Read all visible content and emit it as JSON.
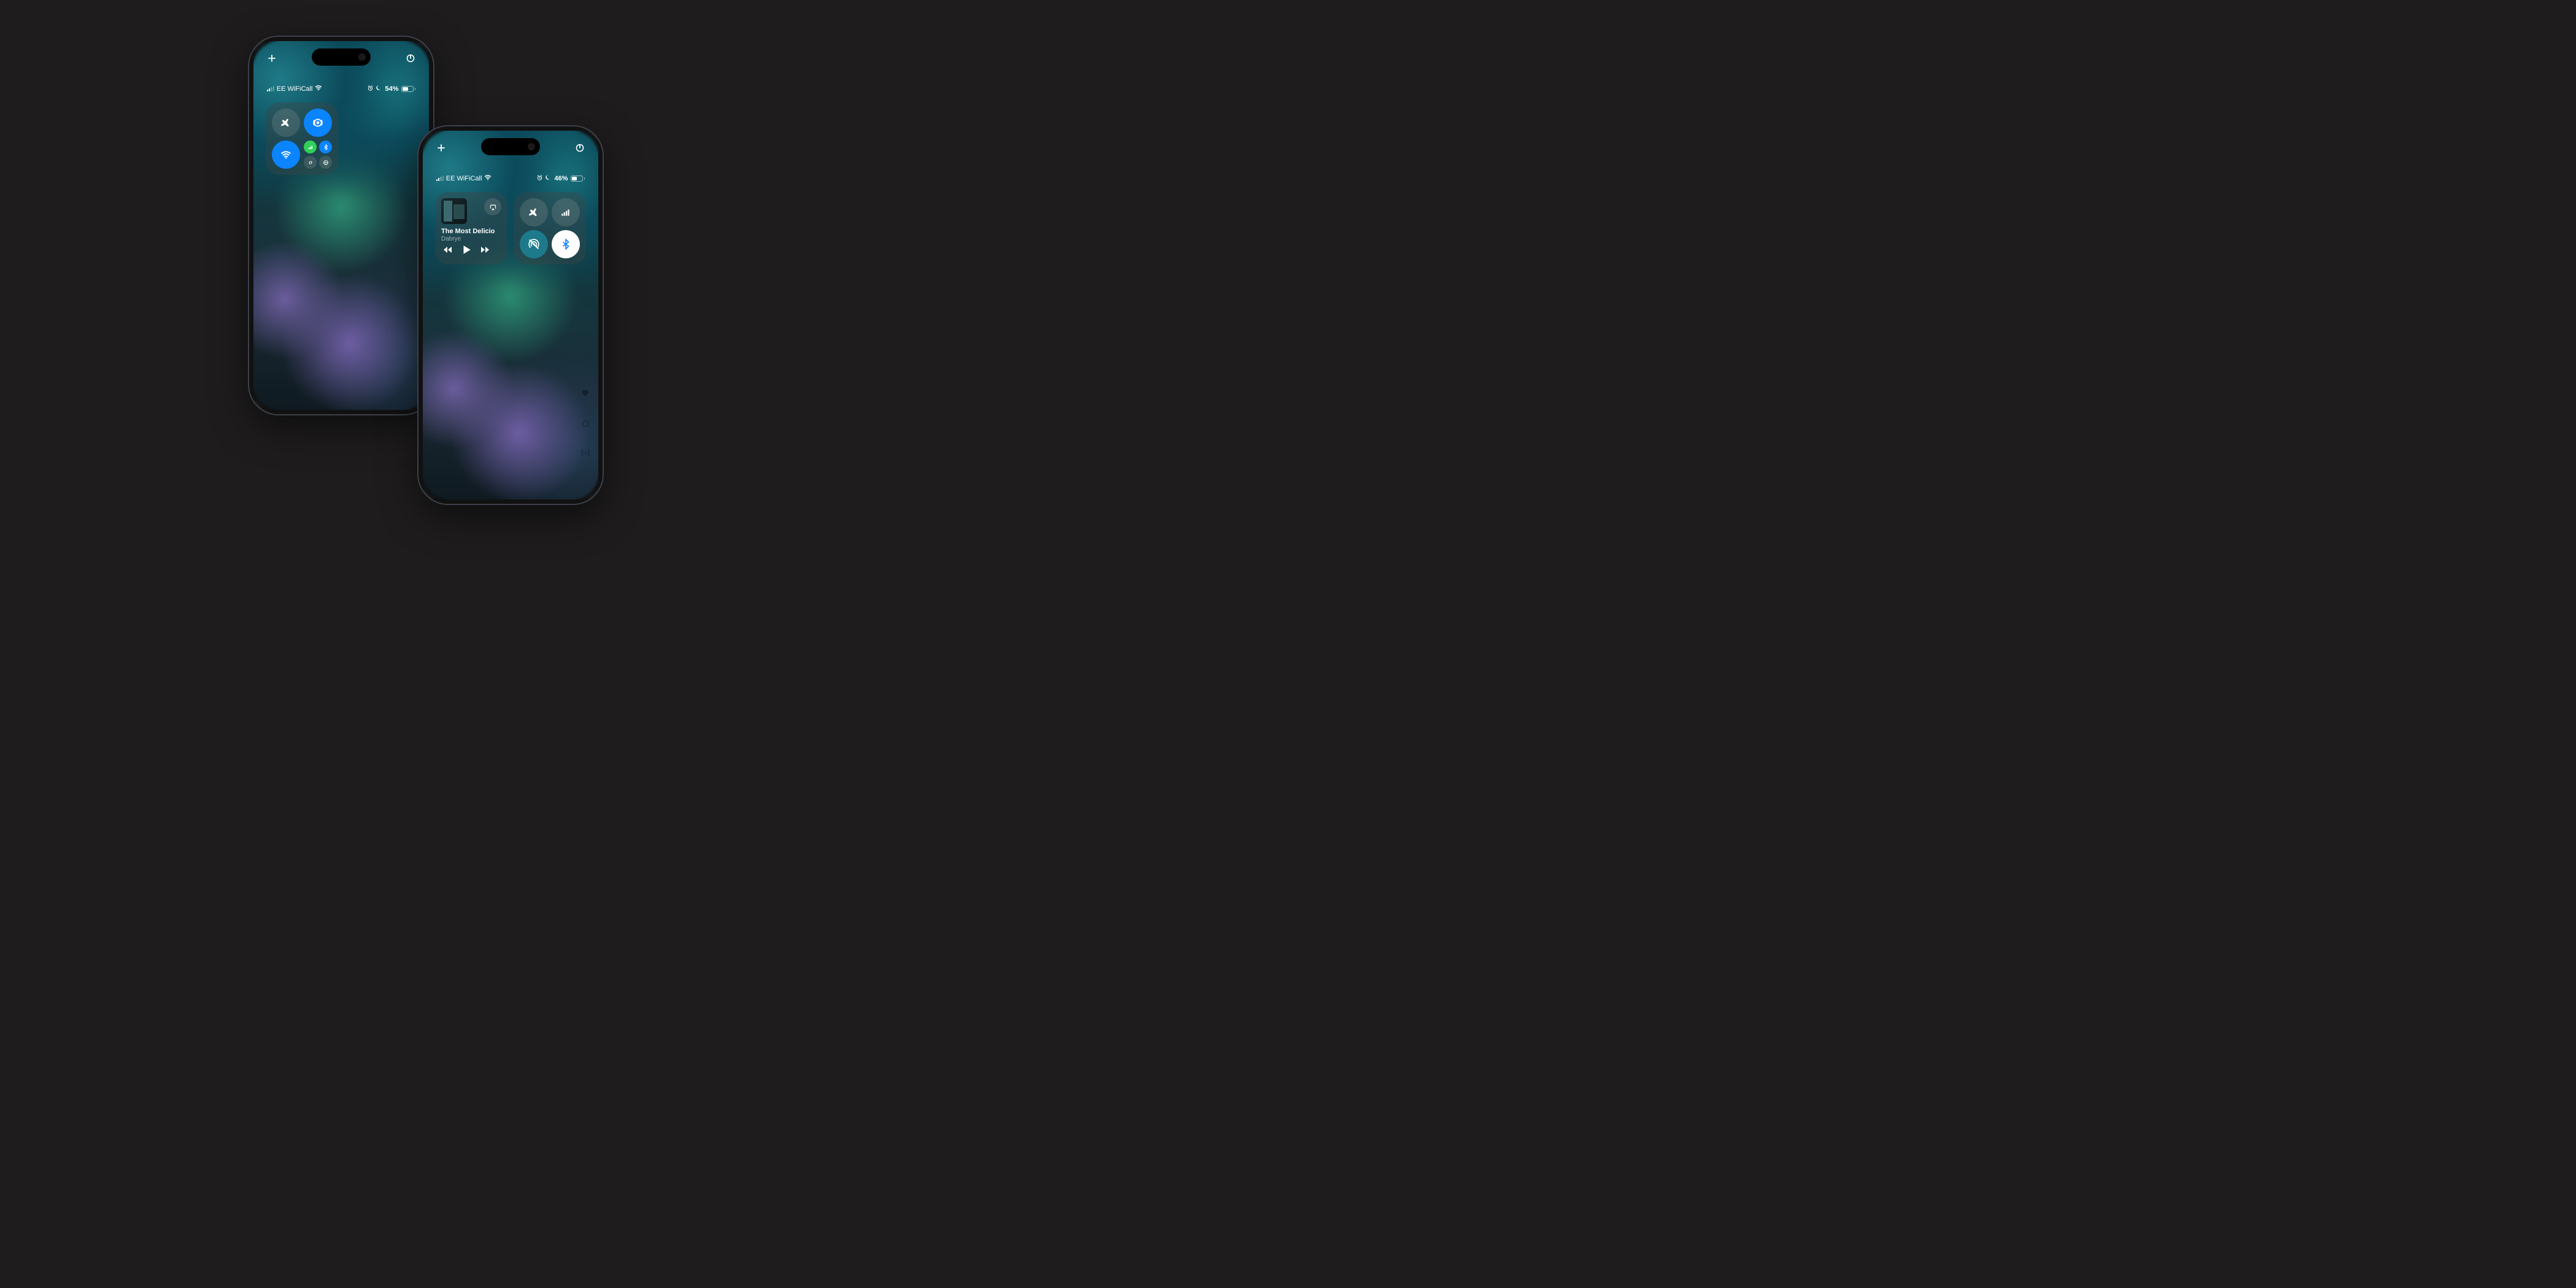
{
  "phones": {
    "left": {
      "status": {
        "signal_active_bars": 2,
        "carrier": "EE WiFiCall",
        "wifi": true,
        "alarm": true,
        "dnd": true,
        "battery_percent": "54%",
        "battery_fill": 0.54
      },
      "connectivity": {
        "airplane": {
          "active": false
        },
        "airdrop": {
          "active": true
        },
        "wifi": {
          "active": true
        },
        "cellular": {
          "active": true,
          "color": "green"
        },
        "bluetooth": {
          "active": true
        },
        "hotspot": {
          "active": false
        },
        "vpn": {
          "active": false
        }
      }
    },
    "right": {
      "status": {
        "signal_active_bars": 2,
        "carrier": "EE WiFiCall",
        "wifi": true,
        "alarm": true,
        "dnd": true,
        "battery_percent": "46%",
        "battery_fill": 0.46
      },
      "music": {
        "track": "The Most Delicio",
        "artist": "Dabrye"
      },
      "connectivity": {
        "airplane": {
          "active": false
        },
        "cellular": {
          "active": false
        },
        "hotspot": {
          "active": true,
          "struck": true
        },
        "bluetooth": {
          "active": true,
          "white": true
        }
      }
    }
  }
}
